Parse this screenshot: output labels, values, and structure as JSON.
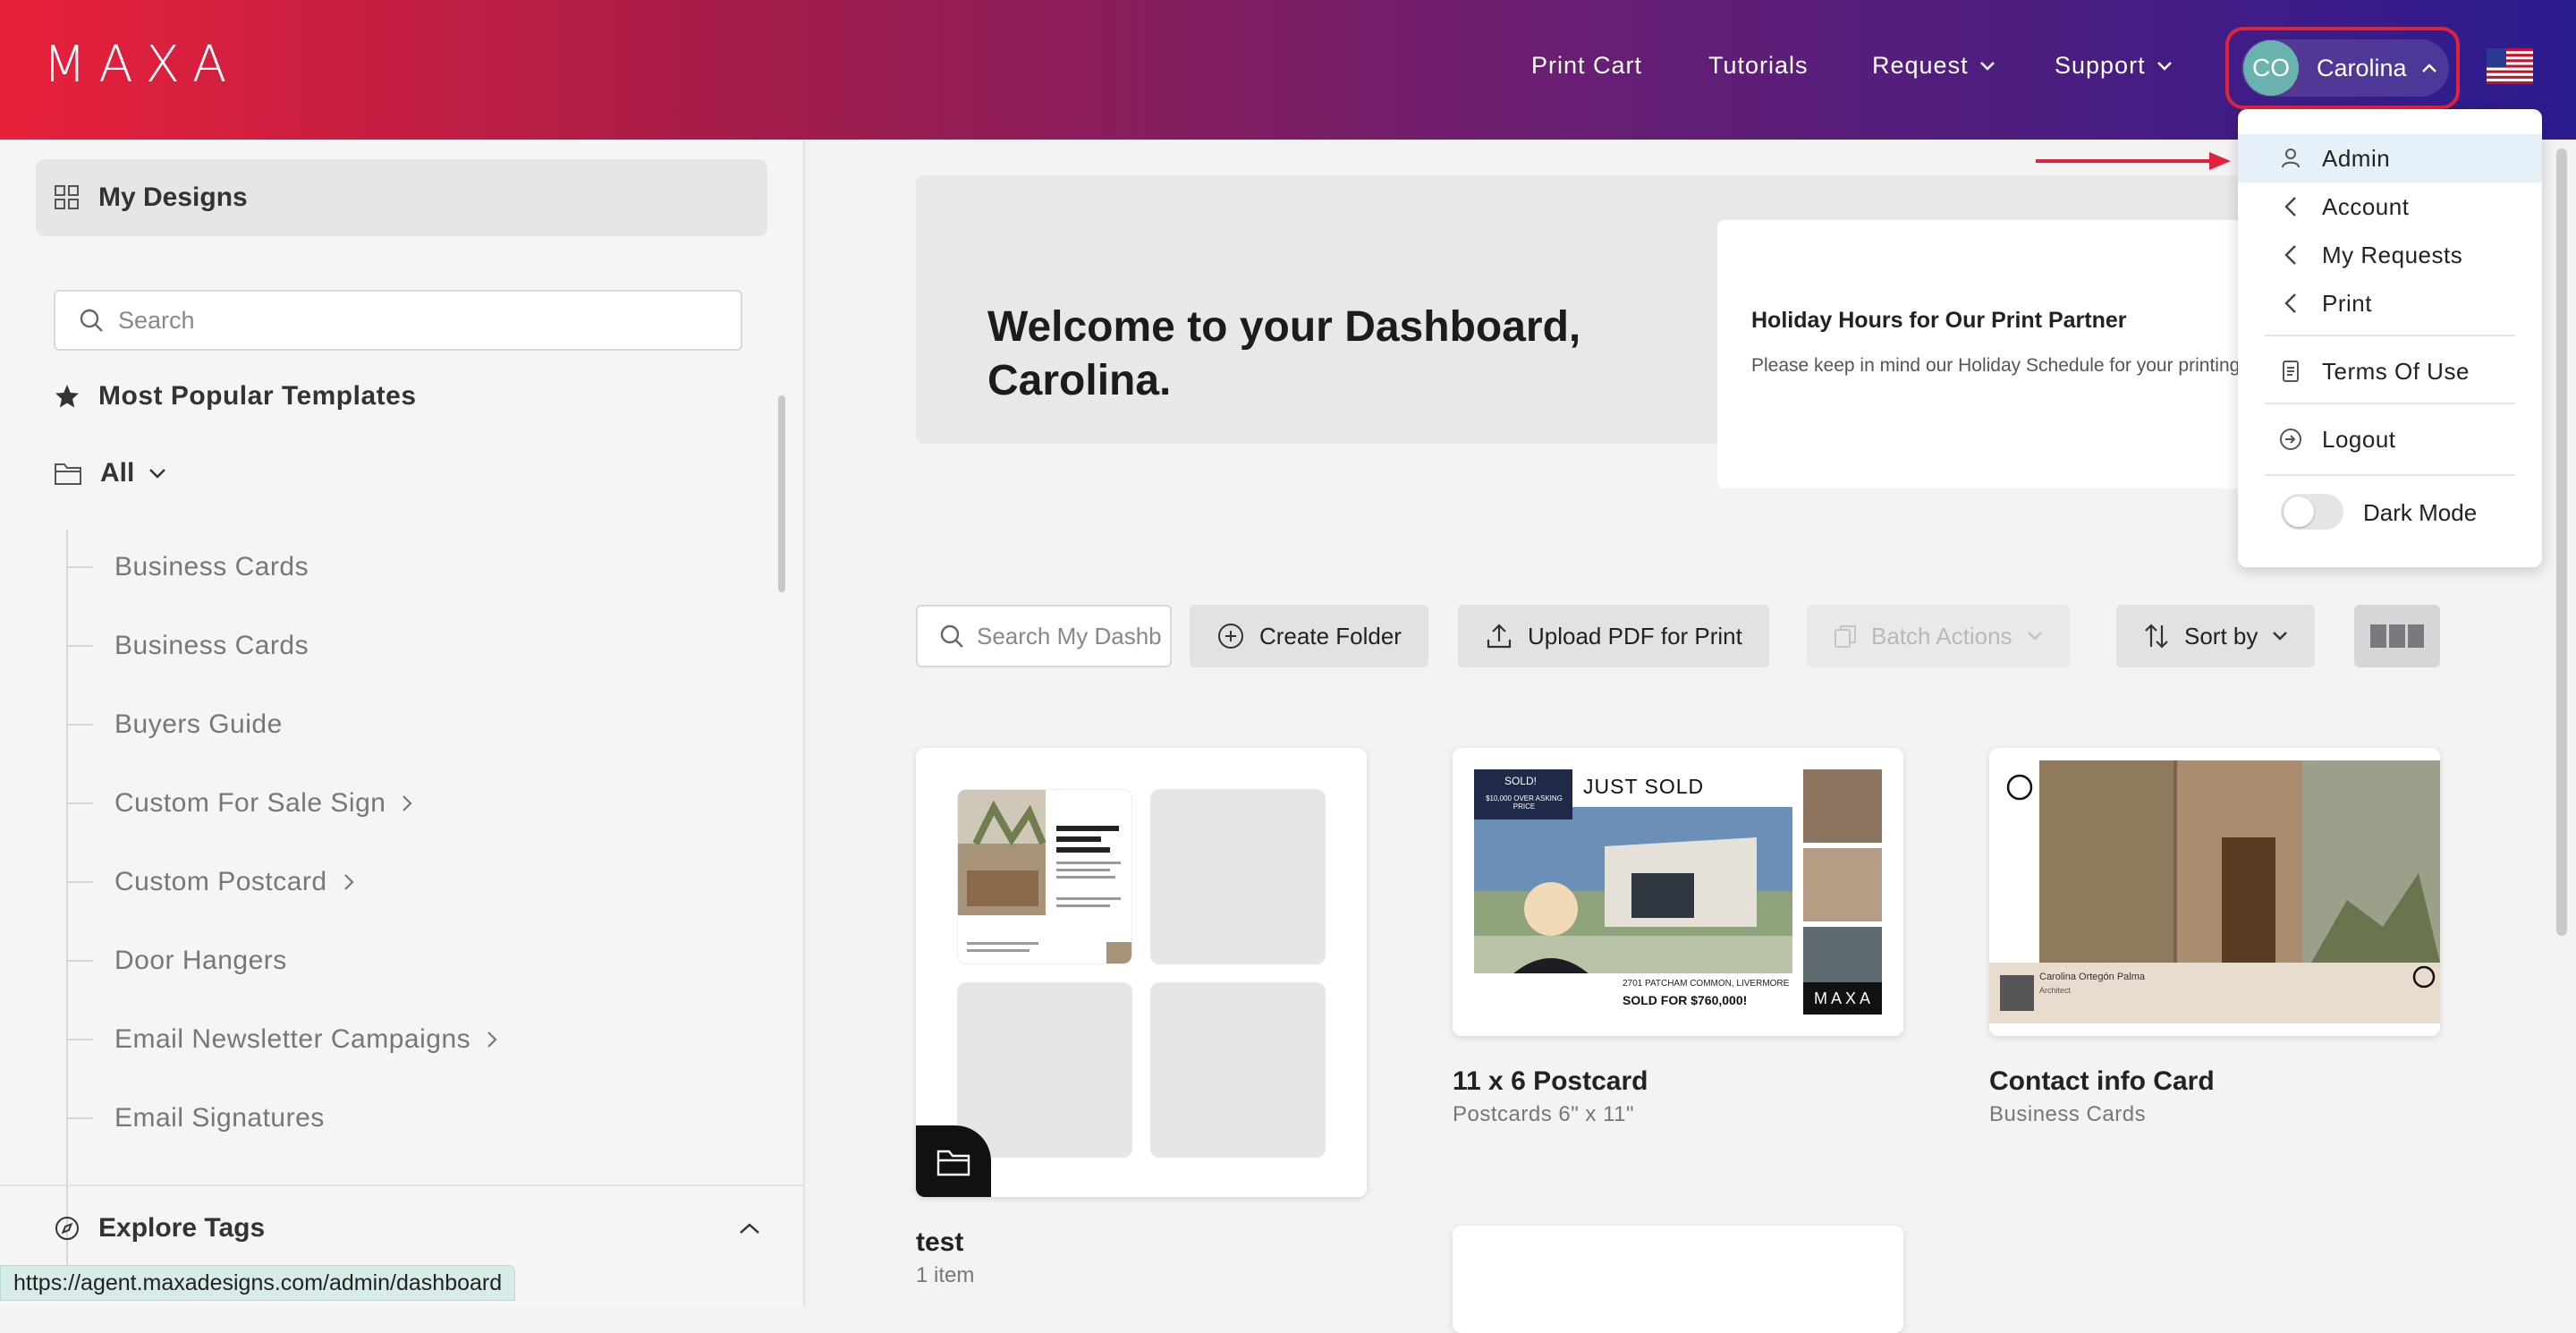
{
  "header": {
    "logo": "MAXA",
    "nav": [
      {
        "label": "Print Cart",
        "has_chevron": false
      },
      {
        "label": "Tutorials",
        "has_chevron": false
      },
      {
        "label": "Request",
        "has_chevron": true
      },
      {
        "label": "Support",
        "has_chevron": true
      }
    ],
    "user": {
      "initials": "CO",
      "name": "Carolina"
    },
    "flag_icon": "us-flag-icon"
  },
  "sidebar": {
    "my_designs": "My Designs",
    "search_placeholder": "Search",
    "most_popular": "Most Popular Templates",
    "all_label": "All",
    "items": [
      {
        "label": "Business Cards",
        "has_chevron": false
      },
      {
        "label": "Business Cards",
        "has_chevron": false
      },
      {
        "label": "Buyers Guide",
        "has_chevron": false
      },
      {
        "label": "Custom For Sale Sign",
        "has_chevron": true
      },
      {
        "label": "Custom Postcard",
        "has_chevron": true
      },
      {
        "label": "Door Hangers",
        "has_chevron": false
      },
      {
        "label": "Email Newsletter Campaigns",
        "has_chevron": true
      },
      {
        "label": "Email Signatures",
        "has_chevron": false
      }
    ],
    "explore_tags": "Explore Tags"
  },
  "main": {
    "welcome": "Welcome to your Dashboard, Carolina.",
    "notice": {
      "title": "Holiday Hours for Our Print Partner",
      "body": "Please keep in mind our Holiday Schedule for your printing needs!"
    },
    "toolbar": {
      "search_placeholder": "Search My Dashboard",
      "create_folder": "Create Folder",
      "upload_pdf": "Upload PDF for Print",
      "batch_actions": "Batch Actions",
      "sort_by": "Sort by"
    },
    "folder": {
      "title": "test",
      "count": "1 item"
    },
    "cards": [
      {
        "title": "11 x 6 Postcard",
        "subtitle": "Postcards 6\" x 11\"",
        "thumb": {
          "sold_tag": "SOLD!",
          "asking": "$10,000 OVER ASKING PRICE",
          "headline": "JUST SOLD",
          "address": "2701 PATCHAM COMMON, LIVERMORE",
          "sold_for": "SOLD FOR  $760,000!",
          "brand": "MAXA"
        }
      },
      {
        "title": "Contact info Card",
        "subtitle": "Business Cards",
        "thumb": {
          "name": "Carolina Ortegón Palma",
          "role": "Architect"
        }
      }
    ]
  },
  "user_menu": {
    "items": [
      {
        "label": "Admin",
        "icon": "user-icon",
        "active": true
      },
      {
        "label": "Account",
        "icon": "chevron-left-icon",
        "active": false
      },
      {
        "label": "My Requests",
        "icon": "chevron-left-icon",
        "active": false
      },
      {
        "label": "Print",
        "icon": "chevron-left-icon",
        "active": false
      },
      {
        "label": "Terms Of Use",
        "icon": "document-icon",
        "active": false
      },
      {
        "label": "Logout",
        "icon": "logout-icon",
        "active": false
      }
    ],
    "dark_mode": "Dark Mode",
    "dark_mode_on": false
  },
  "status_url": "https://agent.maxadesigns.com/admin/dashboard",
  "colors": {
    "header_start": "#e8213a",
    "header_end": "#2b1c8f",
    "highlight_border": "#e0233a",
    "avatar": "#6ab3ae",
    "menu_active": "#e6f0f8"
  }
}
